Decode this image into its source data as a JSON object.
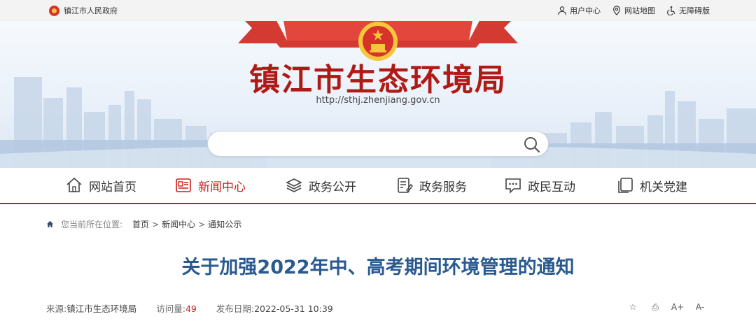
{
  "topbar": {
    "gov_link": "镇江市人民政府",
    "links": [
      {
        "label": "用户中心",
        "icon": "user-icon"
      },
      {
        "label": "网站地图",
        "icon": "map-pin-icon"
      },
      {
        "label": "无障碍版",
        "icon": "accessibility-icon"
      }
    ]
  },
  "banner": {
    "title": "镇江市生态环境局",
    "url": "http://sthj.zhenjiang.gov.cn",
    "search_placeholder": ""
  },
  "nav": {
    "items": [
      {
        "label": "网站首页",
        "icon": "home-icon",
        "active": false
      },
      {
        "label": "新闻中心",
        "icon": "newspaper-icon",
        "active": true
      },
      {
        "label": "政务公开",
        "icon": "layers-icon",
        "active": false
      },
      {
        "label": "政务服务",
        "icon": "document-edit-icon",
        "active": false
      },
      {
        "label": "政民互动",
        "icon": "chat-icon",
        "active": false
      },
      {
        "label": "机关党建",
        "icon": "pages-icon",
        "active": false
      }
    ]
  },
  "breadcrumb": {
    "prefix": "您当前所在位置:",
    "items": [
      "首页",
      "新闻中心",
      "通知公示"
    ],
    "separator": ">"
  },
  "article": {
    "title": "关于加强2022年中、高考期间环境管理的通知",
    "source_label": "来源:",
    "source": "镇江市生态环境局",
    "visits_label": "访问量:",
    "visits": "49",
    "date_label": "发布日期:",
    "date": "2022-05-31 10:39"
  },
  "tools": [
    {
      "icon": "star-icon",
      "glyph": "☆"
    },
    {
      "icon": "print-icon",
      "glyph": "⎙"
    },
    {
      "icon": "font-increase-icon",
      "glyph": "A+"
    },
    {
      "icon": "font-decrease-icon",
      "glyph": "A-"
    }
  ],
  "colors": {
    "accent_red": "#c9211e",
    "title_blue": "#2a5a8f",
    "banner_bg": "#eaf1fa"
  }
}
